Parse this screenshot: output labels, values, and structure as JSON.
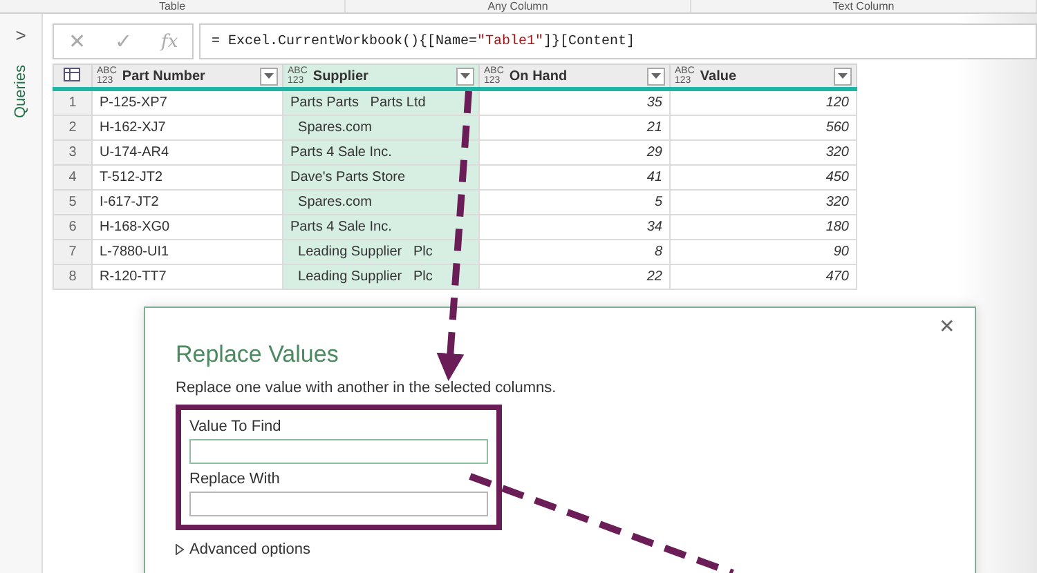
{
  "ribbon": {
    "groups": [
      "Table",
      "Any Column",
      "Text Column"
    ]
  },
  "queries_pane": {
    "expand_glyph": ">",
    "label": "Queries"
  },
  "formula_bar": {
    "cancel": "✕",
    "confirm": "✓",
    "fx": "fx",
    "formula": {
      "before": "= Excel.CurrentWorkbook(){[Name=",
      "string": "\"Table1\"",
      "after": "]}[Content]"
    }
  },
  "table": {
    "columns": [
      {
        "name": "Part Number",
        "type_label": [
          "ABC",
          "123"
        ],
        "selected": false
      },
      {
        "name": "Supplier",
        "type_label": [
          "ABC",
          "123"
        ],
        "selected": true
      },
      {
        "name": "On Hand",
        "type_label": [
          "ABC",
          "123"
        ],
        "selected": false
      },
      {
        "name": "Value",
        "type_label": [
          "ABC",
          "123"
        ],
        "selected": false
      }
    ],
    "rows": [
      {
        "index": "1",
        "cells": [
          "P-125-XP7",
          "Parts Parts   Parts Ltd",
          "35",
          "120"
        ]
      },
      {
        "index": "2",
        "cells": [
          "H-162-XJ7",
          "  Spares.com",
          "21",
          "560"
        ]
      },
      {
        "index": "3",
        "cells": [
          "U-174-AR4",
          "Parts 4 Sale Inc.",
          "29",
          "320"
        ]
      },
      {
        "index": "4",
        "cells": [
          "T-512-JT2",
          "Dave's Parts Store",
          "41",
          "450"
        ]
      },
      {
        "index": "5",
        "cells": [
          "I-617-JT2",
          "  Spares.com",
          "5",
          "320"
        ]
      },
      {
        "index": "6",
        "cells": [
          "H-168-XG0",
          "Parts 4 Sale Inc.",
          "34",
          "180"
        ]
      },
      {
        "index": "7",
        "cells": [
          "L-7880-UI1",
          "  Leading Supplier   Plc",
          "8",
          "90"
        ]
      },
      {
        "index": "8",
        "cells": [
          "R-120-TT7",
          "  Leading Supplier   Plc",
          "22",
          "470"
        ]
      }
    ]
  },
  "dialog": {
    "title": "Replace Values",
    "close": "✕",
    "description": "Replace one value with another in the selected columns.",
    "fields": [
      {
        "label": "Value To Find",
        "focused": true
      },
      {
        "label": "Replace With",
        "focused": false
      }
    ],
    "advanced": {
      "label": "Advanced options",
      "expanded": false
    }
  }
}
